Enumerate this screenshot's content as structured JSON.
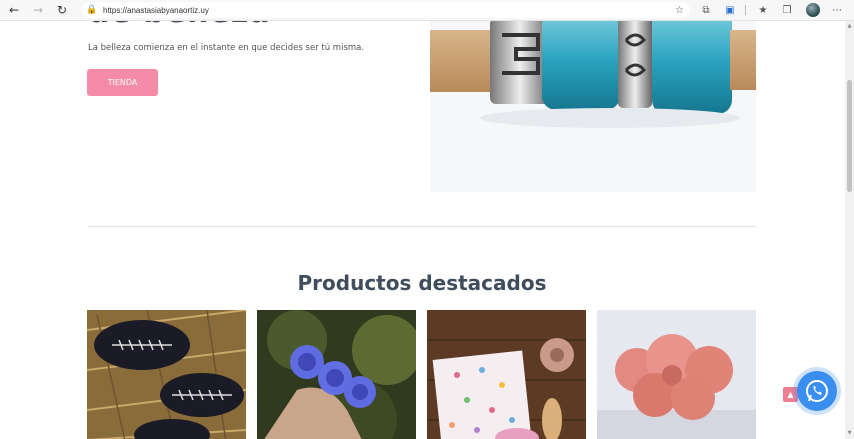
{
  "browser": {
    "url": "https://anastasiabyanaortiz.uy",
    "icons": [
      "back-icon",
      "forward-icon",
      "refresh-icon",
      "lock-icon",
      "star-icon",
      "collections-icon",
      "save-icon",
      "favorites-icon",
      "extensions-icon",
      "profile-avatar"
    ]
  },
  "hero": {
    "title": "de belleza",
    "subtitle": "La belleza comienza en el instante en que decides ser tú misma.",
    "cta_label": "TIENDA"
  },
  "featured": {
    "title": "Productos destacados",
    "products": [
      {
        "image": "black-stones-with-embroidery"
      },
      {
        "image": "purple-rose-hair-clip"
      },
      {
        "image": "floral-wash-cloth-with-scrunchie-and-brush"
      },
      {
        "image": "pink-flower-headband"
      }
    ]
  },
  "colors": {
    "accent": "#f48ca7",
    "heading": "#3f4d5c",
    "whatsapp": "#3a8ef0",
    "totop": "#f07d90"
  }
}
